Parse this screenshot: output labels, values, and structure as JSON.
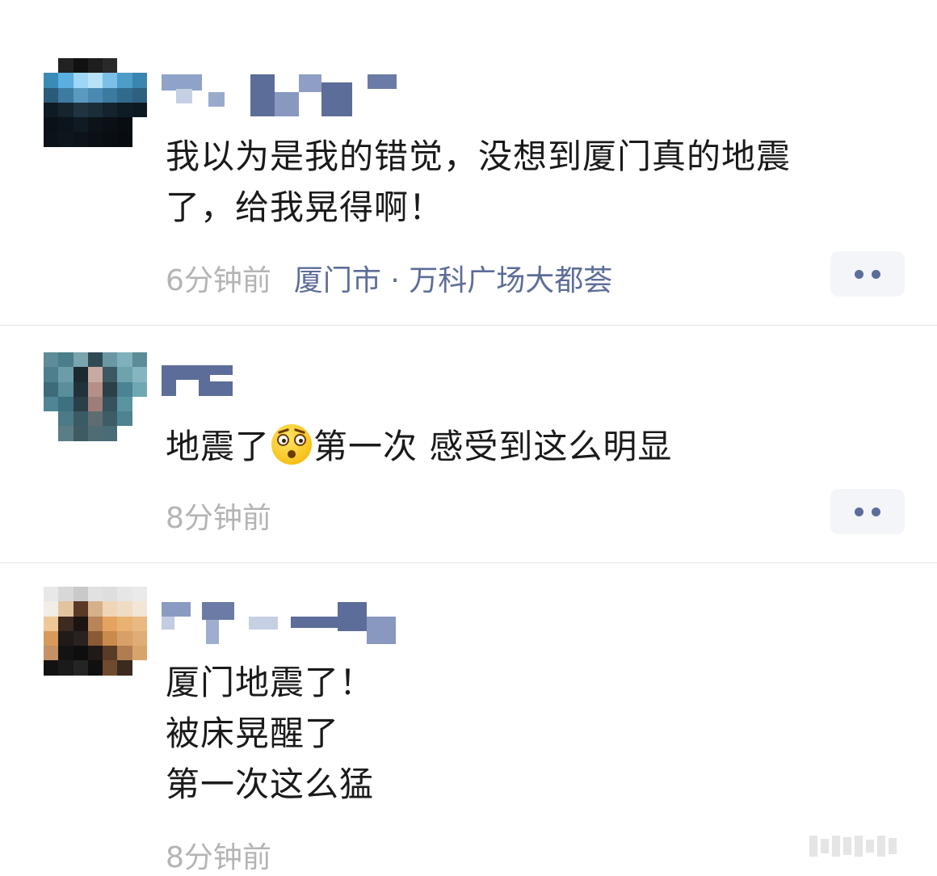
{
  "comments": [
    {
      "content_lines": [
        "我以为是我的错觉，没想到厦门真的地震",
        "了，给我晃得啊！"
      ],
      "time": "6分钟前",
      "location": "厦门市 · 万科广场大都荟",
      "more_icon": "more-dots-icon"
    },
    {
      "content_before_emoji": "地震了",
      "emoji": "shocked-face-emoji",
      "content_after_emoji": "第一次 感受到这么明显",
      "time": "8分钟前",
      "more_icon": "more-dots-icon"
    },
    {
      "content_lines": [
        "厦门地震了！",
        "被床晃醒了",
        "第一次这么猛"
      ],
      "time": "8分钟前"
    }
  ],
  "colors": {
    "meta_gray": "#b4b4b4",
    "location_blue": "#5d6d99",
    "more_button_bg": "#f4f5f8"
  }
}
